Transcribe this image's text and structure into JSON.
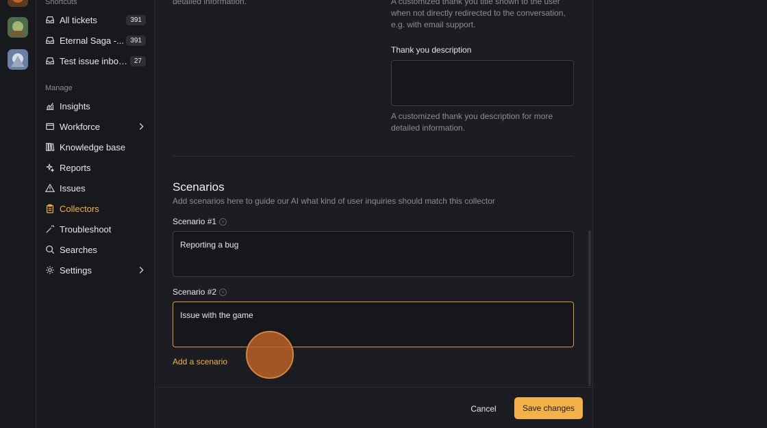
{
  "sidebar": {
    "shortcuts_label": "Shortcuts",
    "shortcuts": [
      {
        "label": "All tickets",
        "count": "391"
      },
      {
        "label": "Eternal Saga -...",
        "count": "391"
      },
      {
        "label": "Test issue inbox...",
        "count": "27"
      }
    ],
    "manage_label": "Manage",
    "items": [
      {
        "label": "Insights",
        "icon": "chart-icon"
      },
      {
        "label": "Workforce",
        "icon": "calendar-icon",
        "has_children": true
      },
      {
        "label": "Knowledge base",
        "icon": "books-icon"
      },
      {
        "label": "Reports",
        "icon": "sparkle-icon"
      },
      {
        "label": "Issues",
        "icon": "warning-icon"
      },
      {
        "label": "Collectors",
        "icon": "clipboard-icon",
        "active": true
      },
      {
        "label": "Troubleshoot",
        "icon": "wand-icon"
      },
      {
        "label": "Searches",
        "icon": "search-icon"
      },
      {
        "label": "Settings",
        "icon": "gear-icon",
        "has_children": true
      }
    ]
  },
  "form": {
    "top_left_hint": "detailed information.",
    "thank_title_hint": "A customized thank you title shown to the user when not directly redirected to the conversation, e.g. with email support.",
    "thank_desc_label": "Thank you description",
    "thank_desc_value": "",
    "thank_desc_hint": "A customized thank you description for more detailed information.",
    "scenarios_heading": "Scenarios",
    "scenarios_sub": "Add scenarios here to guide our AI what kind of user inquiries should match this collector",
    "scenarios": [
      {
        "label": "Scenario #1",
        "value": "Reporting a bug"
      },
      {
        "label": "Scenario #2",
        "value": "Issue with the game"
      }
    ],
    "add_scenario": "Add a scenario"
  },
  "footer": {
    "cancel": "Cancel",
    "save": "Save changes"
  },
  "colors": {
    "accent": "#f3b14a",
    "background": "#1b1d22",
    "sidebar": "#18191d"
  }
}
